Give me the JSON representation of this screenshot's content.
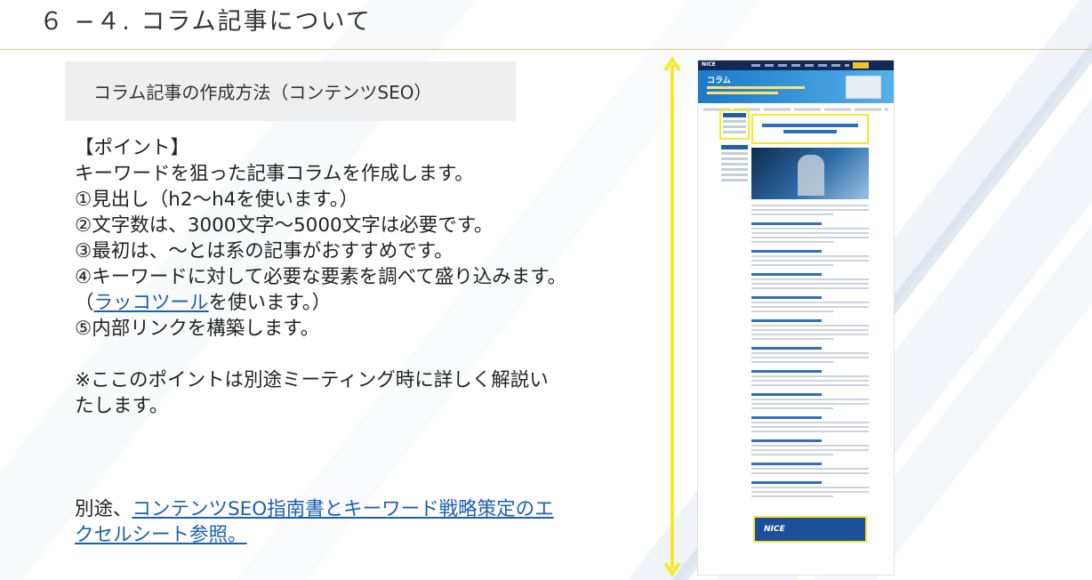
{
  "slide": {
    "title": "６ −４. コラム記事について",
    "subtitle": "コラム記事の作成方法（コンテンツSEO）"
  },
  "points": {
    "heading": "【ポイント】",
    "intro": "キーワードを狙った記事コラムを作成します。",
    "p1": "①見出し（h2〜h4を使います。）",
    "p2": "②文字数は、3000文字〜5000文字は必要です。",
    "p3": "③最初は、〜とは系の記事がおすすめです。",
    "p4": "④キーワードに対して必要な要素を調べて盛り込みます。",
    "p4b_open": "（",
    "p4b_link": "ラッコツール",
    "p4b_rest": "を使います。）",
    "p5": "⑤内部リンクを構築します。",
    "note_line1": "※ここのポイントは別途ミーティング時に詳しく解説い",
    "note_line2": "たします。"
  },
  "footer": {
    "prefix": "別途、",
    "link_line1": "コンテンツSEO指南書とキーワード戦略策定のエ",
    "link_line2": "クセルシート参照。"
  },
  "thumbnail": {
    "logo": "NICE",
    "hero_title": "コラム",
    "banner_text": "NICE"
  },
  "colors": {
    "link": "#1a5fb4",
    "highlight": "#f5ea2a",
    "subtitle_bg": "#efefef"
  }
}
